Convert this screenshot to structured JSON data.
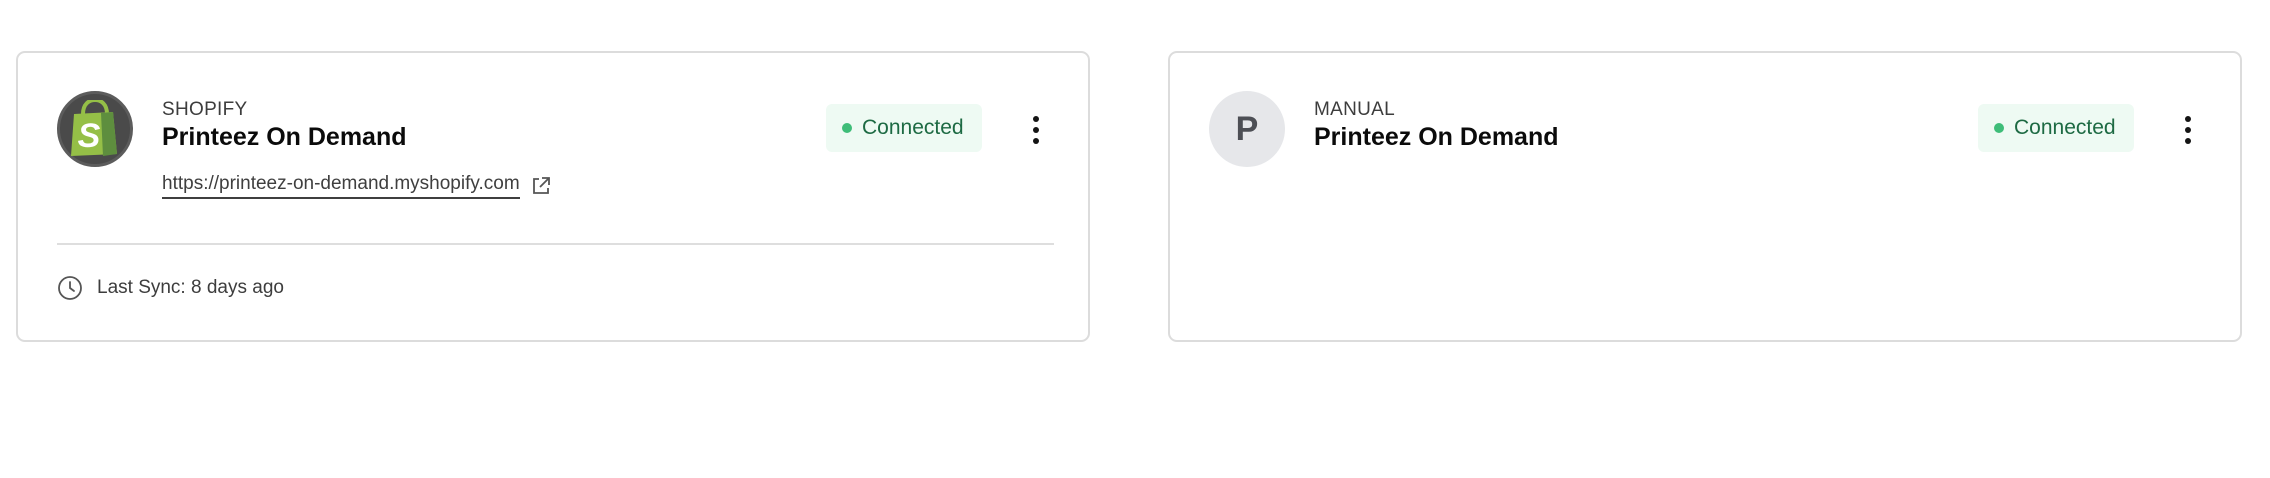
{
  "integrations": [
    {
      "platform": "SHOPIFY",
      "store_name": "Printeez On Demand",
      "url": "https://printeez-on-demand.myshopify.com",
      "status": "Connected",
      "last_sync": "Last Sync: 8 days ago",
      "avatar_icon": "shopify-bag-icon"
    },
    {
      "platform": "MANUAL",
      "store_name": "Printeez On Demand",
      "status": "Connected",
      "avatar_letter": "P"
    }
  ],
  "colors": {
    "status_dot": "#3ebd78",
    "status_bg": "#eefaf3",
    "status_text": "#1d6a43",
    "shopify_green": "#95bf47"
  }
}
